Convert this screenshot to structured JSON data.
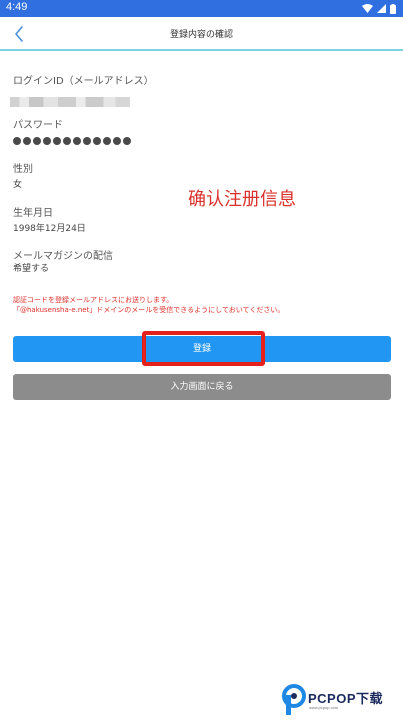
{
  "status_bar": {
    "time": "4:49"
  },
  "header": {
    "title": "登録内容の確認"
  },
  "fields": {
    "email": {
      "label": "ログインID（メールアドレス）"
    },
    "password": {
      "label": "パスワード",
      "masked_count": 12
    },
    "gender": {
      "label": "性別",
      "value": "女"
    },
    "birthday": {
      "label": "生年月日",
      "value": "1998年12月24日"
    },
    "newsletter": {
      "label": "メールマガジンの配信",
      "value": "希望する"
    }
  },
  "annotation": "确认注册信息",
  "notice": {
    "line1": "認証コードを登録メールアドレスにお送りします。",
    "line2": "「@hakusensha-e.net」ドメインのメールを受信できるようにしておいてください。"
  },
  "buttons": {
    "register": "登録",
    "back_to_input": "入力画面に戻る"
  },
  "watermark": {
    "brand": "PCPOP下载",
    "sub": "www.pcpop.com"
  },
  "colors": {
    "status_bar": "#2f6fe0",
    "primary_button": "#2196f3",
    "secondary_button": "#8c8c8c",
    "notice_text": "#e0302a",
    "highlight": "#e4221b",
    "header_underline": "#7ed3e2"
  }
}
